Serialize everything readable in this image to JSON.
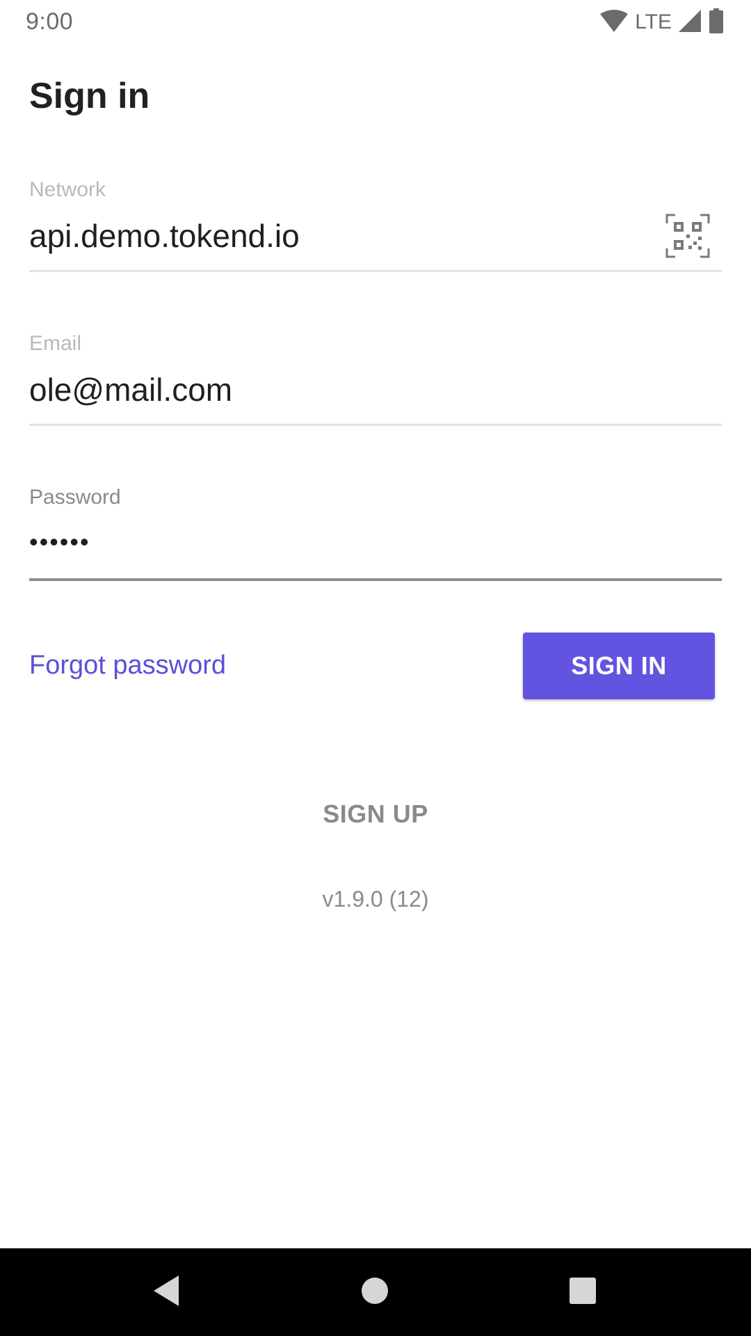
{
  "status_bar": {
    "time": "9:00",
    "network_type": "LTE",
    "icons": [
      "wifi-icon",
      "cell-signal-icon",
      "battery-icon"
    ]
  },
  "page": {
    "title": "Sign in"
  },
  "form": {
    "network": {
      "label": "Network",
      "value": "api.demo.tokend.io",
      "action_icon": "qr-code-icon"
    },
    "email": {
      "label": "Email",
      "value": "ole@mail.com"
    },
    "password": {
      "label": "Password",
      "value": "••••••"
    }
  },
  "actions": {
    "forgot_password": "Forgot password",
    "sign_in": "SIGN IN",
    "sign_up": "SIGN UP"
  },
  "version": "v1.9.0 (12)",
  "nav_bar": {
    "icons": [
      "back-icon",
      "home-icon",
      "recents-icon"
    ]
  },
  "colors": {
    "accent": "#6253e1",
    "link": "#5b4fd9",
    "nav_bar": "#000000"
  }
}
